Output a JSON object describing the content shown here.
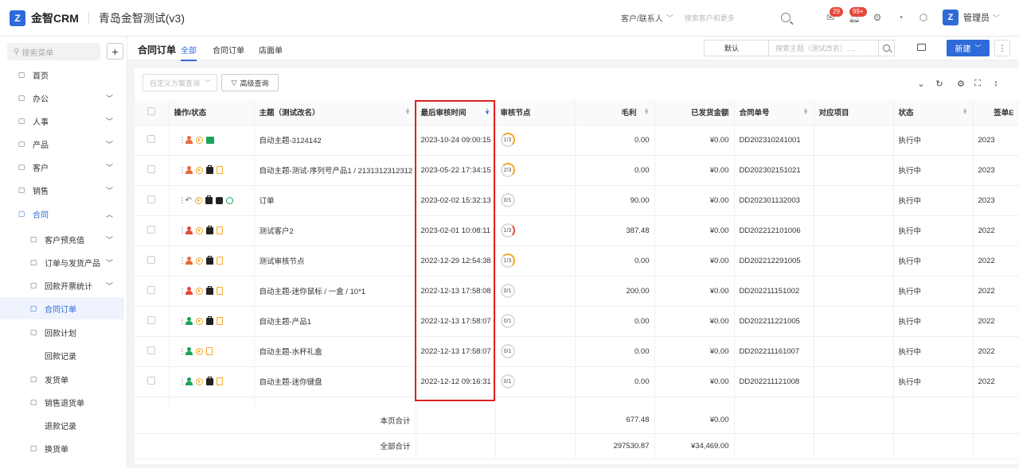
{
  "app": {
    "logo_text": "金智CRM",
    "org_name": "青岛金智测试(v3)",
    "search_scope": "客户/联系人",
    "search_placeholder": "搜索客户和更多",
    "badges": {
      "messages": "29",
      "notifications": "99+"
    },
    "user_name": "管理员",
    "logo_letter": "Z"
  },
  "sidebar": {
    "search_placeholder": "搜索菜单",
    "items": [
      {
        "label": "首页",
        "icon": "home-icon"
      },
      {
        "label": "办公",
        "icon": "office-icon",
        "expandable": true
      },
      {
        "label": "人事",
        "icon": "people-icon",
        "expandable": true
      },
      {
        "label": "产品",
        "icon": "product-icon",
        "expandable": true
      },
      {
        "label": "客户",
        "icon": "customer-icon",
        "expandable": true
      },
      {
        "label": "销售",
        "icon": "sales-icon",
        "expandable": true
      },
      {
        "label": "合同",
        "icon": "contract-icon",
        "expandable": true,
        "expanded": true
      },
      {
        "label": "客户预充值",
        "icon": "doc-icon",
        "expandable": true,
        "sub": true
      },
      {
        "label": "订单与发货产品",
        "icon": "doc-icon",
        "expandable": true,
        "sub": true
      },
      {
        "label": "回款开票统计",
        "icon": "doc-icon",
        "expandable": true,
        "sub": true
      },
      {
        "label": "合同订单",
        "icon": "doc-icon",
        "sub": true,
        "current": true
      },
      {
        "label": "回款计划",
        "icon": "plan-icon",
        "sub": true
      },
      {
        "label": "回款记录",
        "icon": "",
        "sub": true
      },
      {
        "label": "发货单",
        "icon": "ship-icon",
        "sub": true
      },
      {
        "label": "销售退货单",
        "icon": "return-icon",
        "sub": true
      },
      {
        "label": "退款记录",
        "icon": "",
        "sub": true
      },
      {
        "label": "换货单",
        "icon": "exchange-icon",
        "sub": true
      }
    ]
  },
  "page": {
    "title": "合同订单",
    "tabs": [
      "全部",
      "合同订单",
      "店面单"
    ],
    "active_tab": 0,
    "view_select": "默认",
    "subject_search_placeholder": "搜索主题（测试改名）, ...",
    "new_button": "新建",
    "filter_placeholder": "自定义方案查询",
    "advanced_query": "高级查询"
  },
  "table": {
    "columns": [
      "操作/状态",
      "主题（测试改名）",
      "最后审核时间",
      "审核节点",
      "毛利",
      "已发货金额",
      "合同单号",
      "对应项目",
      "状态",
      "签单E"
    ],
    "rows": [
      {
        "person": "#e86a3a",
        "icons": [
          "play",
          "gbag"
        ],
        "subject": "自动主题-3124142",
        "audit_time": "2023-10-24 09:00:15",
        "node": "1/3",
        "ring": "orange",
        "profit": "0.00",
        "shipped": "¥0.00",
        "contract_no": "DD202310241001",
        "project": "",
        "status": "执行中",
        "sign": "2023"
      },
      {
        "person": "#e86a3a",
        "icons": [
          "play",
          "bag",
          "doc"
        ],
        "subject": "自动主题-测试-序列号产品1 / 2131312312312",
        "audit_time": "2023-05-22 17:34:15",
        "node": "2/3",
        "ring": "orange",
        "profit": "0.00",
        "shipped": "¥0.00",
        "contract_no": "DD202302151021",
        "project": "",
        "status": "执行中",
        "sign": "2023"
      },
      {
        "person": "",
        "icons": [
          "undo",
          "play",
          "bag",
          "box",
          "green"
        ],
        "subject": "订单",
        "audit_time": "2023-02-02 15:32:13",
        "node": "0/1",
        "ring": "gray",
        "profit": "90.00",
        "shipped": "¥0.00",
        "contract_no": "DD202301132003",
        "project": "",
        "status": "执行中",
        "sign": "2023"
      },
      {
        "person": "#e5483c",
        "icons": [
          "play",
          "bag",
          "doc"
        ],
        "subject": "测试客户2",
        "audit_time": "2023-02-01 10:08:11",
        "node": "1/3",
        "ring": "red",
        "profit": "387.48",
        "shipped": "¥0.00",
        "contract_no": "DD202212101006",
        "project": "",
        "status": "执行中",
        "sign": "2022"
      },
      {
        "person": "#e86a3a",
        "icons": [
          "play",
          "bag",
          "doc"
        ],
        "subject": "测试审核节点",
        "audit_time": "2022-12-29 12:54:38",
        "node": "1/3",
        "ring": "orange",
        "profit": "0.00",
        "shipped": "¥0.00",
        "contract_no": "DD202212291005",
        "project": "",
        "status": "执行中",
        "sign": "2022"
      },
      {
        "person": "#e5483c",
        "icons": [
          "play",
          "bag",
          "doc"
        ],
        "subject": "自动主题-迷你鼠标 / 一盒 / 10*1",
        "audit_time": "2022-12-13 17:58:08",
        "node": "0/1",
        "ring": "gray",
        "profit": "200.00",
        "shipped": "¥0.00",
        "contract_no": "DD202211151002",
        "project": "",
        "status": "执行中",
        "sign": "2022"
      },
      {
        "person": "#1aa35a",
        "icons": [
          "play",
          "bag",
          "doc"
        ],
        "subject": "自动主题-产品1",
        "audit_time": "2022-12-13 17:58:07",
        "node": "0/1",
        "ring": "gray",
        "profit": "0.00",
        "shipped": "¥0.00",
        "contract_no": "DD202211221005",
        "project": "",
        "status": "执行中",
        "sign": "2022"
      },
      {
        "person": "#1aa35a",
        "icons": [
          "play",
          "doc"
        ],
        "subject": "自动主题-水杯礼盒",
        "audit_time": "2022-12-13 17:58:07",
        "node": "0/1",
        "ring": "gray",
        "profit": "0.00",
        "shipped": "¥0.00",
        "contract_no": "DD202211161007",
        "project": "",
        "status": "执行中",
        "sign": "2022"
      },
      {
        "person": "#1aa35a",
        "icons": [
          "play",
          "bag",
          "doc"
        ],
        "subject": "自动主题-迷你键盘",
        "audit_time": "2022-12-12 09:16:31",
        "node": "0/1",
        "ring": "gray",
        "profit": "0.00",
        "shipped": "¥0.00",
        "contract_no": "DD202211121008",
        "project": "",
        "status": "执行中",
        "sign": "2022"
      }
    ],
    "summary": {
      "page_label": "本页合计",
      "page_profit": "677.48",
      "page_shipped": "¥0.00",
      "all_label": "全部合计",
      "all_profit": "297530.87",
      "all_shipped": "¥34,469.00"
    }
  },
  "colors": {
    "accent": "#2f6bd8",
    "highlight_border": "#e02020",
    "orange": "#f5a623",
    "red": "#e5483c",
    "green": "#1aa35a"
  }
}
